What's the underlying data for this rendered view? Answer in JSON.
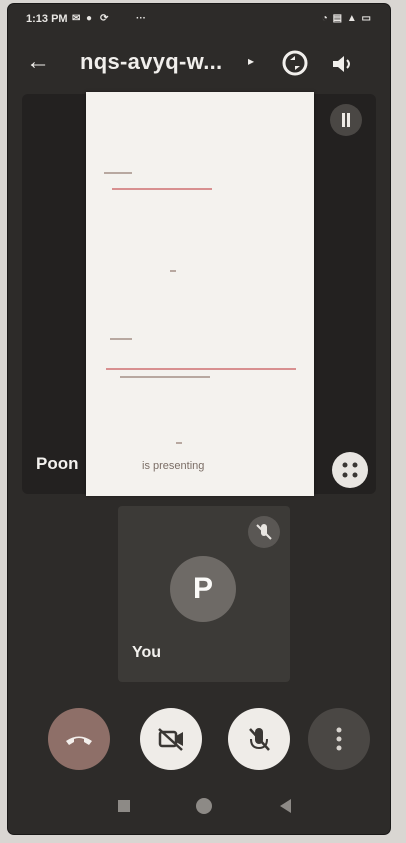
{
  "status_bar": {
    "time": "1:13 PM",
    "left_icons": [
      "notification-icon",
      "chat-icon",
      "sync-icon",
      "more-dots-icon"
    ],
    "right_icons": [
      "alarm-icon",
      "data-icon",
      "signal-icon",
      "battery-icon"
    ]
  },
  "header": {
    "back_icon": "←",
    "meeting_code": "nqs-avyq-w...",
    "caret": "▸"
  },
  "remote_participant": {
    "name": "Poon",
    "presenting_caption": "is presenting"
  },
  "self_tile": {
    "avatar_letter": "P",
    "label": "You"
  },
  "controls": [
    "end-call-button",
    "camera-off-button",
    "mic-off-button",
    "more-options-button"
  ],
  "colors": {
    "background": "#2d2b29",
    "end_call": "#8e6f68",
    "control_light": "#efece8"
  }
}
